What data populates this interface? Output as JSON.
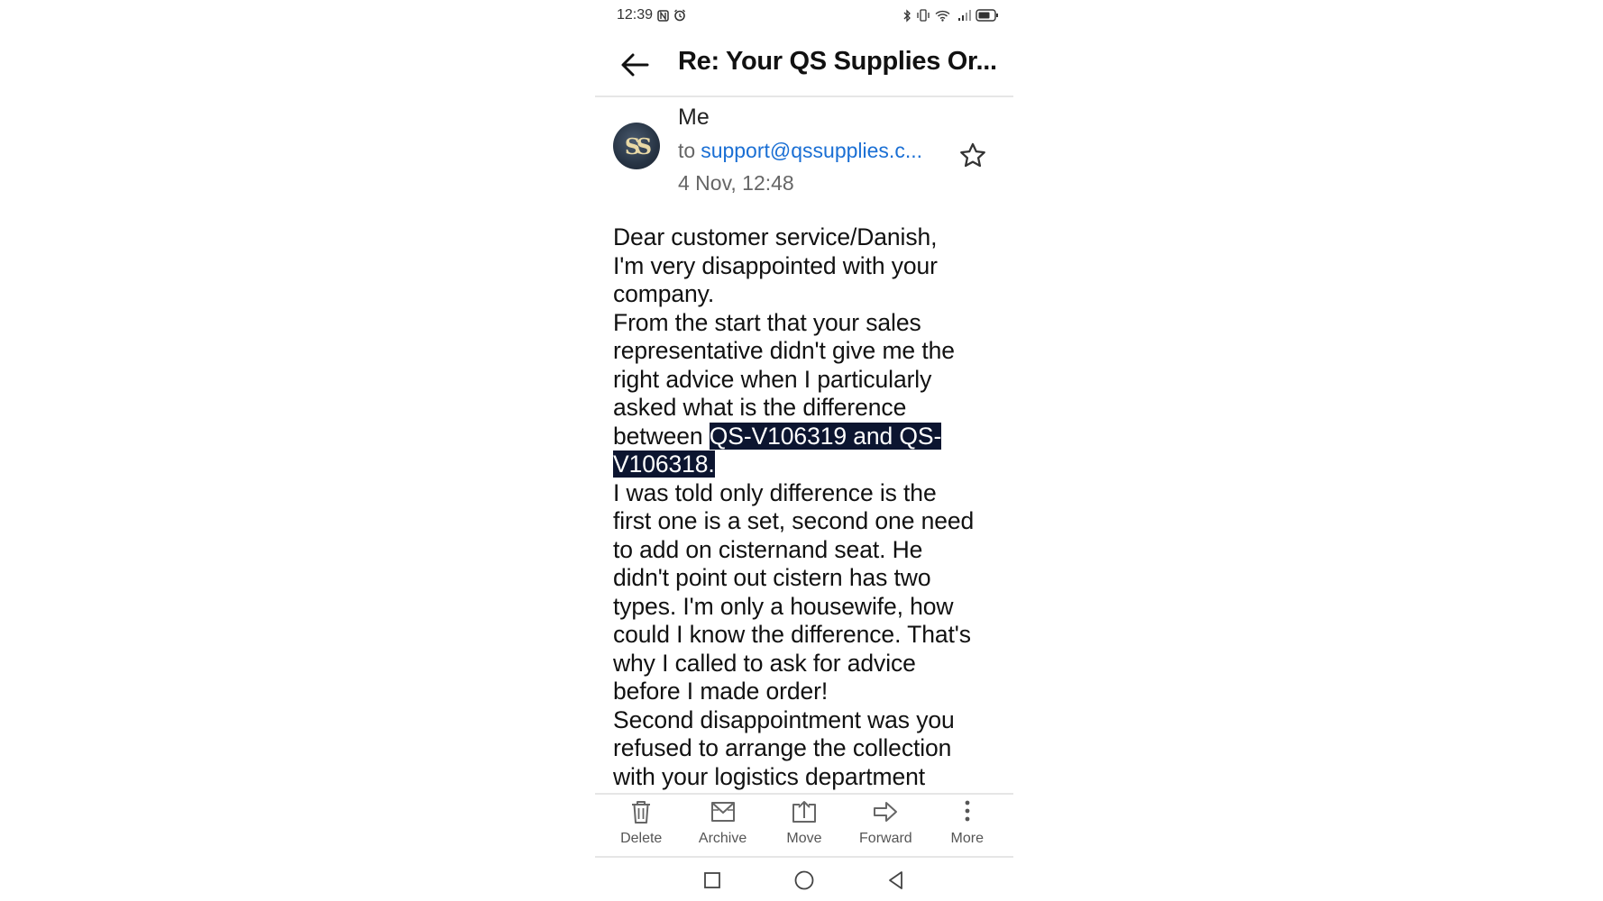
{
  "status_bar": {
    "time": "12:39",
    "left_icons": [
      "nfc-icon",
      "alarm-icon"
    ],
    "right_icons": [
      "bluetooth-icon",
      "vibrate-icon",
      "wifi-icon",
      "signal-icon",
      "battery-icon"
    ]
  },
  "header": {
    "subject": "Re: Your QS Supplies Or..."
  },
  "message": {
    "avatar_text": "SS",
    "sender": "Me",
    "to_label": "to",
    "recipient": "support@qssupplies.c...",
    "date": "4 Nov, 12:48",
    "body_lines": [
      "Dear customer service/Danish,",
      "I'm very disappointed with your",
      "company.",
      "From the start that your sales",
      "representative didn't give me the",
      "right advice when I particularly",
      "asked what is the difference",
      "between ",
      "I was told only difference is the",
      "first one is a set, second one need",
      "to add on cisternand seat. He",
      "didn't point out cistern has two",
      "types. I'm only a housewife, how",
      "could I know the difference. That's",
      "why I called to ask for advice",
      "before I made order!",
      "Second disappointment was you",
      "refused to arrange the collection",
      "with your logistics department"
    ],
    "highlight_part1": "QS-V106319 and QS-",
    "highlight_part2": "V106318."
  },
  "toolbar": {
    "delete": "Delete",
    "archive": "Archive",
    "move": "Move",
    "forward": "Forward",
    "more": "More"
  },
  "colors": {
    "link": "#1a6fd4",
    "highlight_bg": "#0c1530",
    "muted_text": "#666666"
  }
}
